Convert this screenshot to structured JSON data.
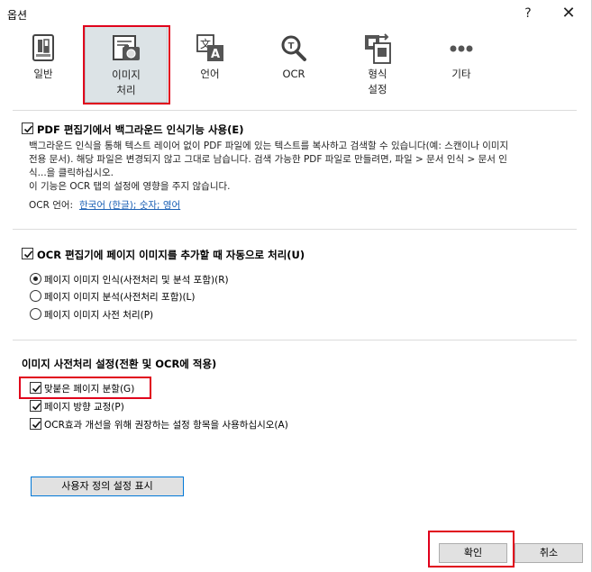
{
  "window": {
    "title": "옵션",
    "help": "?",
    "close": "✕"
  },
  "toolbar": {
    "items": [
      {
        "label": "일반",
        "icon": "general-settings-icon"
      },
      {
        "label": "이미지\n처리",
        "icon": "image-processing-icon",
        "active": true
      },
      {
        "label": "언어",
        "icon": "language-icon"
      },
      {
        "label": "OCR",
        "icon": "ocr-magnifier-icon"
      },
      {
        "label": "형식\n설정",
        "icon": "format-settings-icon"
      },
      {
        "label": "기타",
        "icon": "more-icon"
      }
    ]
  },
  "section1": {
    "checkbox_label": "PDF 편집기에서 백그라운드 인식기능 사용(E)",
    "checked": true,
    "desc_line1": "백그라운드 인식을 통해 텍스트 레이어 없이 PDF 파일에 있는 텍스트를 복사하고 검색할 수 있습니다(예: 스캔이나 이미지",
    "desc_line2": "전용 문서). 해당 파일은 변경되지 않고 그대로 남습니다. 검색 가능한 PDF 파일로 만들려면, 파일 > 문서 인식 > 문서 인",
    "desc_line3": "식...을 클릭하십시오.",
    "desc_line4": "이 기능은 OCR 탭의 설정에 영향을 주지 않습니다.",
    "ocr_lang_label": "OCR 언어:",
    "ocr_lang_value": "한국어 (한글); 숫자; 영어"
  },
  "section2": {
    "checkbox_label": "OCR 편집기에 페이지 이미지를 추가할 때 자동으로 처리(U)",
    "checked": true,
    "radios": [
      {
        "label": "페이지 이미지 인식(사전처리 및 분석 포함)(R)",
        "selected": true
      },
      {
        "label": "페이지 이미지 분석(사전처리 포함)(L)",
        "selected": false
      },
      {
        "label": "페이지 이미지 사전 처리(P)",
        "selected": false
      }
    ]
  },
  "section3": {
    "heading": "이미지 사전처리 설정(전환 및 OCR에 적용)",
    "options": [
      {
        "label": "맞붙은 페이지 분할(G)",
        "checked": true
      },
      {
        "label": "페이지 방향 교정(P)",
        "checked": true
      },
      {
        "label": "OCR효과 개선을 위해 권장하는 설정 항목을 사용하십시오(A)",
        "checked": true
      }
    ],
    "custom_button": "사용자 정의 설정 표시"
  },
  "footer": {
    "ok": "확인",
    "cancel": "취소"
  },
  "colors": {
    "highlight": "#e0001b",
    "link": "#1a5fb4",
    "active_tab_bg": "#dce3e6"
  }
}
